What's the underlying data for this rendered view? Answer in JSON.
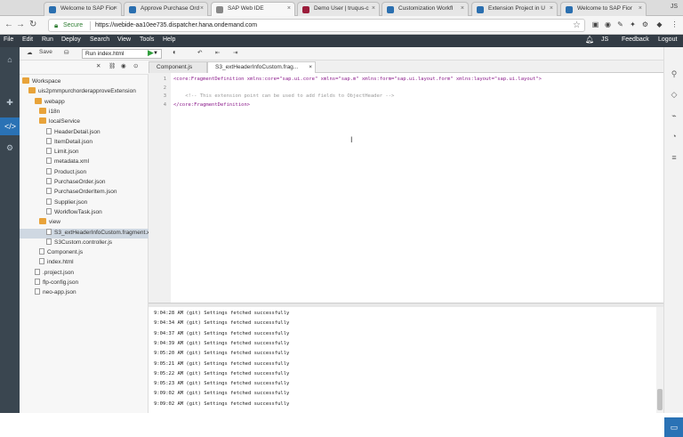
{
  "browser": {
    "tabs": [
      {
        "title": "Welcome to SAP Fior",
        "color": "#2a6fb0"
      },
      {
        "title": "Approve Purchase Ord",
        "color": "#2a6fb0"
      },
      {
        "title": "SAP Web IDE",
        "color": "#888888"
      },
      {
        "title": "Demo User | truqus-c",
        "color": "#9b1d3b"
      },
      {
        "title": "Customization Workfl",
        "color": "#2a6fb0"
      },
      {
        "title": "Extension Project in U",
        "color": "#2a6fb0"
      },
      {
        "title": "Welcome to SAP Fior",
        "color": "#2a6fb0"
      }
    ],
    "user_initials": "JS",
    "secure_label": "Secure",
    "url": "https://webide-aa10ee735.dispatcher.hana.ondemand.com"
  },
  "menu": {
    "items": [
      "File",
      "Edit",
      "Run",
      "Deploy",
      "Search",
      "View",
      "Tools",
      "Help"
    ],
    "user": "JS",
    "feedback": "Feedback",
    "logout": "Logout"
  },
  "toolbar": {
    "save_label": "Save",
    "run_config": "Run index.html"
  },
  "tree": {
    "nodes": [
      {
        "label": "Workspace",
        "type": "folder",
        "level": 0
      },
      {
        "label": "uis2pmmpurchorderapproveExtension",
        "type": "folder",
        "level": 1
      },
      {
        "label": "webapp",
        "type": "folder",
        "level": 2
      },
      {
        "label": "i18n",
        "type": "folder",
        "level": 3
      },
      {
        "label": "localService",
        "type": "folder",
        "level": 3
      },
      {
        "label": "HeaderDetail.json",
        "type": "file",
        "level": 4
      },
      {
        "label": "ItemDetail.json",
        "type": "file",
        "level": 4
      },
      {
        "label": "Limit.json",
        "type": "file",
        "level": 4
      },
      {
        "label": "metadata.xml",
        "type": "file",
        "level": 4
      },
      {
        "label": "Product.json",
        "type": "file",
        "level": 4
      },
      {
        "label": "PurchaseOrder.json",
        "type": "file",
        "level": 4
      },
      {
        "label": "PurchaseOrderItem.json",
        "type": "file",
        "level": 4
      },
      {
        "label": "Supplier.json",
        "type": "file",
        "level": 4
      },
      {
        "label": "WorkflowTask.json",
        "type": "file",
        "level": 4
      },
      {
        "label": "view",
        "type": "folder",
        "level": 3
      },
      {
        "label": "S3_extHeaderInfoCustom.fragment.x",
        "type": "file",
        "level": 4,
        "selected": true
      },
      {
        "label": "S3Custom.controller.js",
        "type": "file",
        "level": 4
      },
      {
        "label": "Component.js",
        "type": "file",
        "level": 3
      },
      {
        "label": "index.html",
        "type": "file",
        "level": 3
      },
      {
        "label": ".project.json",
        "type": "file",
        "level": 2
      },
      {
        "label": "flp-config.json",
        "type": "file",
        "level": 2
      },
      {
        "label": "neo-app.json",
        "type": "file",
        "level": 2
      }
    ]
  },
  "editor": {
    "tabs": [
      {
        "label": "Component.js",
        "active": false
      },
      {
        "label": "S3_extHeaderInfoCustom.frag...",
        "active": true
      }
    ],
    "lines": [
      {
        "num": "1",
        "text": "<core:FragmentDefinition xmlns:core=\"sap.ui.core\" xmlns=\"sap.m\" xmlns:form=\"sap.ui.layout.form\" xmlns:layout=\"sap.ui.layout\">",
        "kind": "tag"
      },
      {
        "num": "2",
        "text": "",
        "kind": "tag"
      },
      {
        "num": "3",
        "text": "    <!-- This extension point can be used to add fields to ObjectHeader -->",
        "kind": "cmt"
      },
      {
        "num": "4",
        "text": "</core:FragmentDefinition>",
        "kind": "tag"
      }
    ]
  },
  "console": {
    "lines": [
      "9:04:28 AM (git) Settings fetched successfully",
      "9:04:34 AM (git) Settings fetched successfully",
      "9:04:37 AM (git) Settings fetched successfully",
      "9:04:39 AM (git) Settings fetched successfully",
      "9:05:20 AM (git) Settings fetched successfully",
      "9:05:21 AM (git) Settings fetched successfully",
      "9:05:22 AM (git) Settings fetched successfully",
      "9:05:23 AM (git) Settings fetched successfully",
      "9:09:02 AM (git) Settings fetched successfully",
      "9:09:02 AM (git) Settings fetched successfully"
    ]
  }
}
